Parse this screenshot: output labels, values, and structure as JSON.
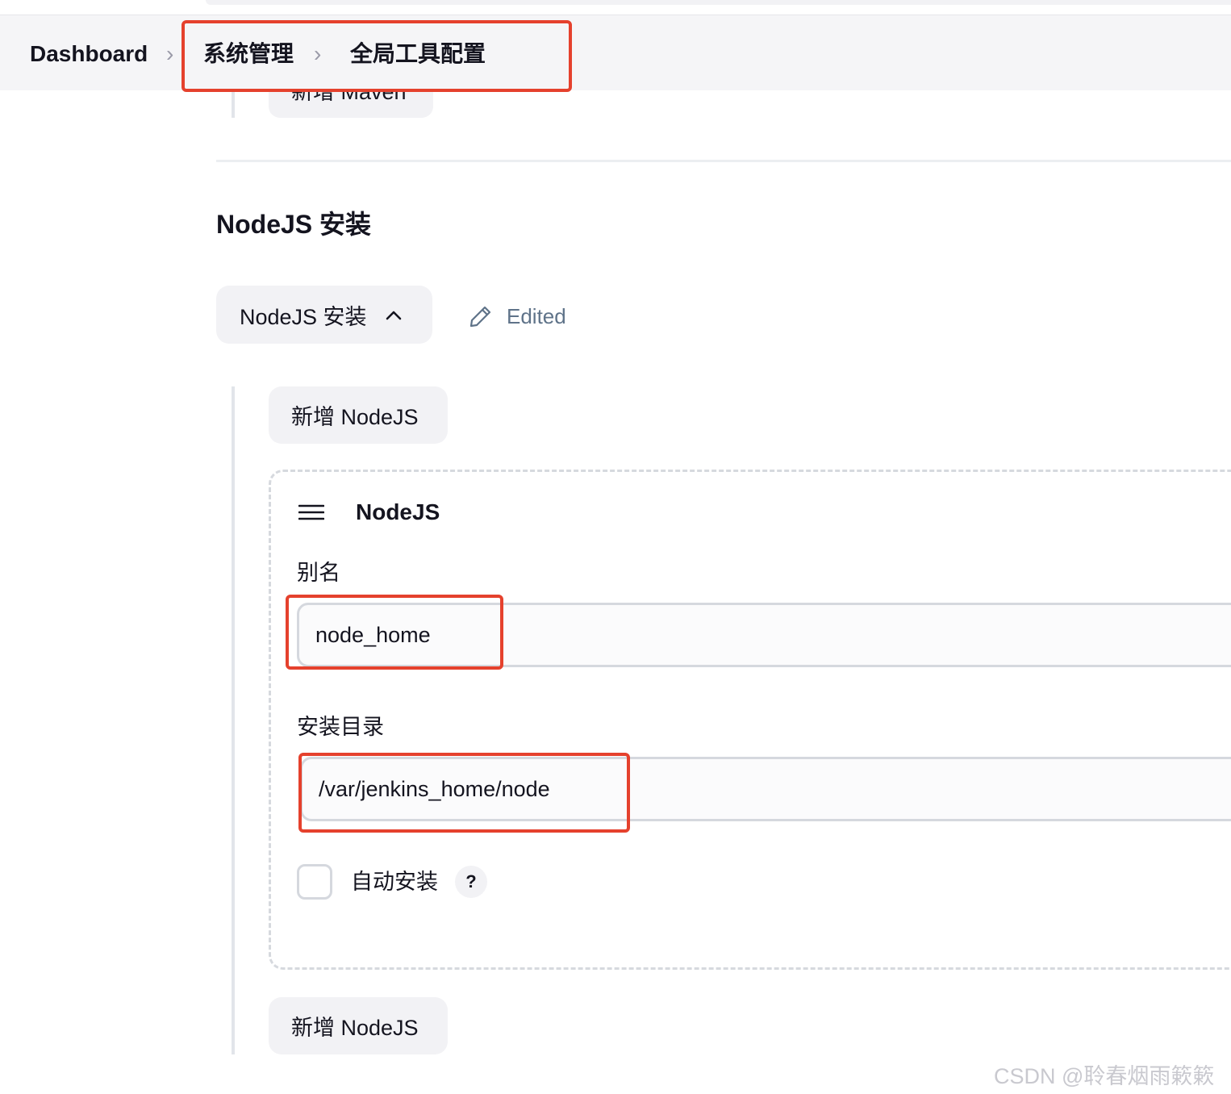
{
  "breadcrumb": {
    "items": [
      "Dashboard",
      "系统管理",
      "全局工具配置"
    ],
    "separator": "›"
  },
  "maven": {
    "add_button_label": "新增 Maven"
  },
  "nodejs_section": {
    "title": "NodeJS 安装",
    "toggle_label": "NodeJS 安装",
    "edited_label": "Edited",
    "add_button_label": "新增 NodeJS",
    "installation": {
      "header": "NodeJS",
      "alias_label": "别名",
      "alias_value": "node_home",
      "home_label": "安装目录",
      "home_value": "/var/jenkins_home/node",
      "auto_install_label": "自动安装",
      "auto_install_checked": false,
      "help_label": "?"
    },
    "add_button_label_bottom": "新增 NodeJS"
  },
  "watermark": "CSDN @聆春烟雨簌簌",
  "colors": {
    "highlight": "#e5412d",
    "edited": "#5f7389",
    "button_bg": "#f2f2f5",
    "header_bg": "#f5f5f7"
  }
}
